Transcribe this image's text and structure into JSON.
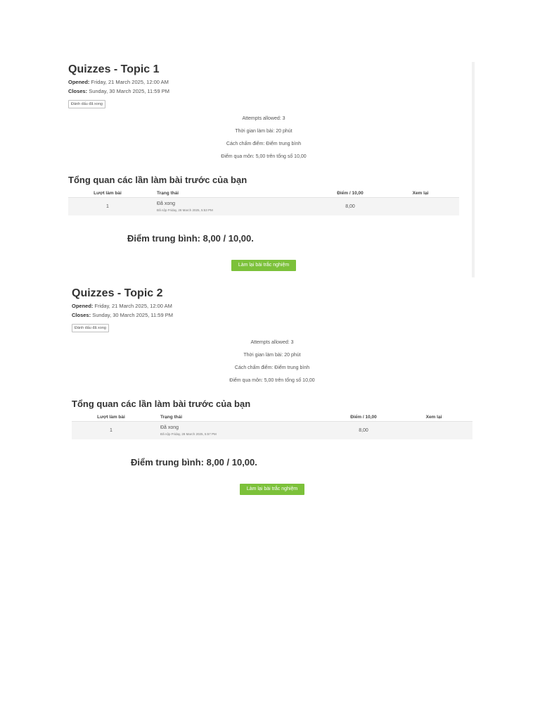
{
  "quizzes": [
    {
      "title": "Quizzes - Topic 1",
      "opened_label": "Opened:",
      "opened_value": "Friday, 21 March 2025, 12:00 AM",
      "closes_label": "Closes:",
      "closes_value": "Sunday, 30 March 2025, 11:59 PM",
      "mark_done_label": "Đánh dấu đã xong",
      "info": [
        "Attempts allowed: 3",
        "Thời gian làm bài: 20 phút",
        "Cách chấm điểm: Điểm trung bình",
        "Điểm qua môn: 5,00 trên tổng số 10,00"
      ],
      "overview_title": "Tổng quan các lần làm bài trước của bạn",
      "table_headers": {
        "attempt": "Lượt làm bài",
        "state": "Trạng thái",
        "grade": "Điểm / 10,00",
        "review": "Xem lại"
      },
      "rows": [
        {
          "attempt": "1",
          "state": "Đã xong",
          "submitted": "Đã nộp Friday, 28 March 2025, 5:53 PM",
          "grade": "8,00",
          "review": ""
        }
      ],
      "average_grade": "Điểm trung bình: 8,00 / 10,00.",
      "retake_label": "Làm lại bài trắc nghiệm"
    },
    {
      "title": "Quizzes - Topic 2",
      "opened_label": "Opened:",
      "opened_value": "Friday, 21 March 2025, 12:00 AM",
      "closes_label": "Closes:",
      "closes_value": "Sunday, 30 March 2025, 11:59 PM",
      "mark_done_label": "Đánh dấu đã xong",
      "info": [
        "Attempts allowed: 3",
        "Thời gian làm bài: 20 phút",
        "Cách chấm điểm: Điểm trung bình",
        "Điểm qua môn: 5,00 trên tổng số 10,00"
      ],
      "overview_title": "Tổng quan các lần làm bài trước của bạn",
      "table_headers": {
        "attempt": "Lượt làm bài",
        "state": "Trạng thái",
        "grade": "Điểm / 10,00",
        "review": "Xem lại"
      },
      "rows": [
        {
          "attempt": "1",
          "state": "Đã xong",
          "submitted": "Đã nộp Friday, 28 March 2025, 5:57 PM",
          "grade": "8,00",
          "review": ""
        }
      ],
      "average_grade": "Điểm trung bình: 8,00 / 10,00.",
      "retake_label": "Làm lại bài trắc nghiệm"
    }
  ],
  "colors": {
    "button_green": "#7cc13a",
    "text": "#333333",
    "row_background": "#f4f4f4"
  }
}
